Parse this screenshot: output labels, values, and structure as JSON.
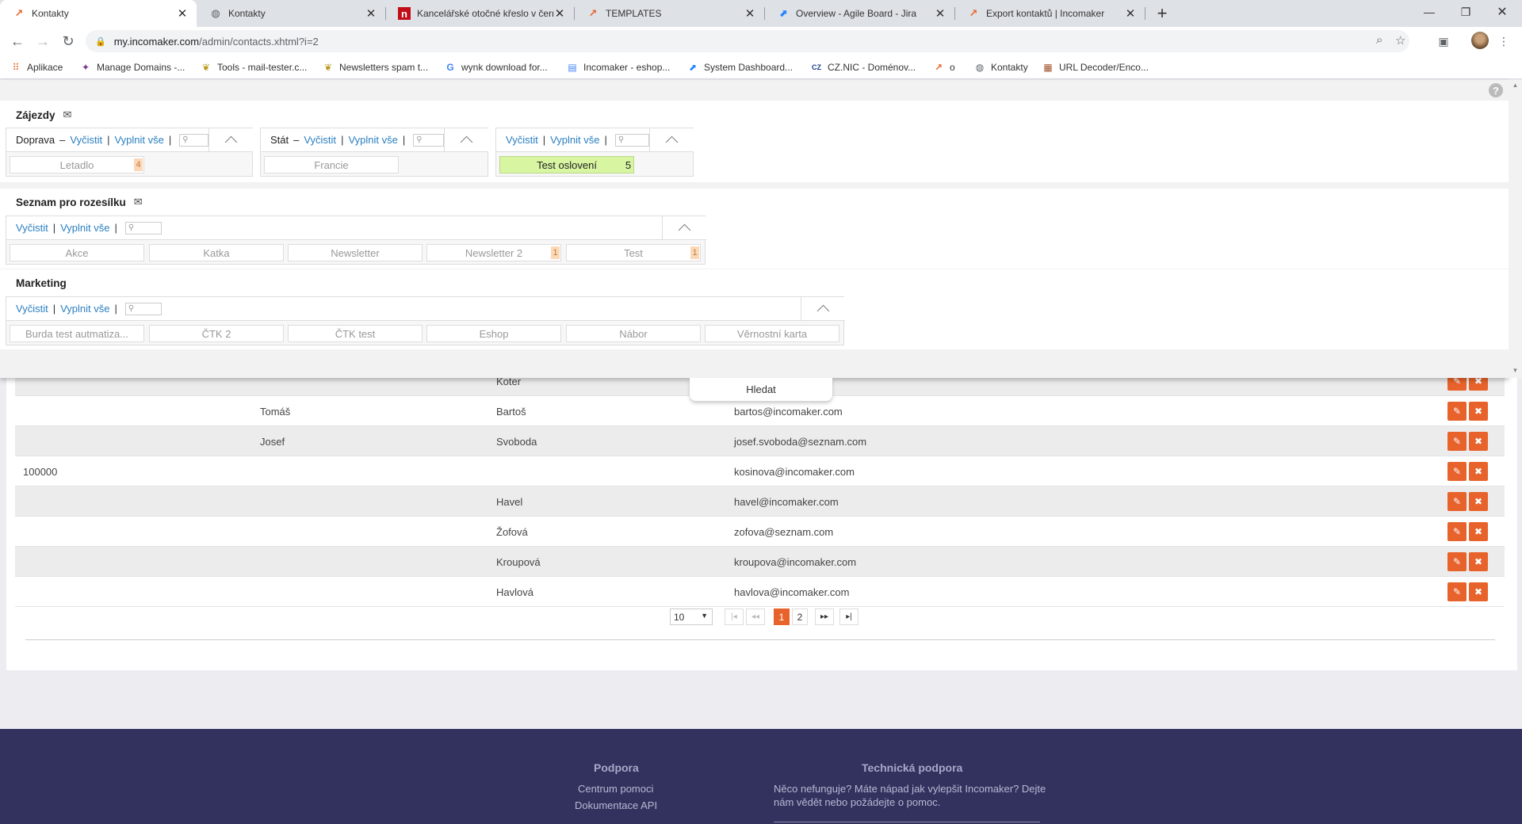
{
  "browser": {
    "tabs": [
      {
        "title": "Kontakty",
        "icon": "incomaker-icon",
        "active": true
      },
      {
        "title": "Kontakty",
        "icon": "globe-icon"
      },
      {
        "title": "Kancelářské otočné křeslo v černé",
        "icon": "n-icon"
      },
      {
        "title": "TEMPLATES",
        "icon": "incomaker-icon"
      },
      {
        "title": "Overview - Agile Board - Jira",
        "icon": "jira-icon"
      },
      {
        "title": "Export kontaktů | Incomaker",
        "icon": "incomaker-icon"
      }
    ],
    "url_domain": "my.incomaker.com",
    "url_path": "/admin/contacts.xhtml?i=2",
    "bookmarks": [
      {
        "label": "Aplikace",
        "icon": "apps-icon"
      },
      {
        "label": "Manage Domains -...",
        "icon": "wedos-icon"
      },
      {
        "label": "Tools - mail-tester.c...",
        "icon": "leaf-icon"
      },
      {
        "label": "Newsletters spam t...",
        "icon": "leaf-icon"
      },
      {
        "label": "wynk download for...",
        "icon": "google-icon"
      },
      {
        "label": "Incomaker - eshop...",
        "icon": "docs-icon"
      },
      {
        "label": "System Dashboard...",
        "icon": "jira-icon"
      },
      {
        "label": "CZ.NIC - Doménov...",
        "icon": "cznic-icon"
      },
      {
        "label": "o",
        "icon": "incomaker-icon"
      },
      {
        "label": "Kontakty",
        "icon": "globe-icon"
      },
      {
        "label": "URL Decoder/Enco...",
        "icon": "decoder-icon"
      }
    ]
  },
  "filters": {
    "zajezdy": {
      "title": "Zájezdy",
      "doprava": {
        "label": "Doprava",
        "clear": "Vyčistit",
        "fill": "Vyplnit vše",
        "chips": [
          {
            "label": "Letadlo",
            "count": "4"
          }
        ]
      },
      "stat": {
        "label": "Stát",
        "clear": "Vyčistit",
        "fill": "Vyplnit vše",
        "chips": [
          {
            "label": "Francie",
            "count": ""
          }
        ]
      },
      "third": {
        "clear": "Vyčistit",
        "fill": "Vyplnit vše",
        "chips": [
          {
            "label": "Test oslovení",
            "count": "5",
            "selected": true
          }
        ]
      }
    },
    "seznam": {
      "title": "Seznam pro rozesílku",
      "clear": "Vyčistit",
      "fill": "Vyplnit vše",
      "chips": [
        {
          "label": "Akce",
          "count": ""
        },
        {
          "label": "Katka",
          "count": ""
        },
        {
          "label": "Newsletter",
          "count": ""
        },
        {
          "label": "Newsletter 2",
          "count": "1"
        },
        {
          "label": "Test",
          "count": "1"
        }
      ]
    },
    "marketing": {
      "title": "Marketing",
      "clear": "Vyčistit",
      "fill": "Vyplnit vše",
      "chips": [
        {
          "label": "Burda test autmatiza...",
          "count": ""
        },
        {
          "label": "ČTK 2",
          "count": ""
        },
        {
          "label": "ČTK test",
          "count": ""
        },
        {
          "label": "Eshop",
          "count": ""
        },
        {
          "label": "Nábor",
          "count": ""
        },
        {
          "label": "Věrnostní karta",
          "count": ""
        }
      ]
    },
    "search_button": "Hledat"
  },
  "table": {
    "partial_row_surname": "Koter",
    "rows": [
      {
        "id": "",
        "first": "Tomáš",
        "last": "Bartoš",
        "email": "bartos@incomaker.com"
      },
      {
        "id": "",
        "first": "Josef",
        "last": "Svoboda",
        "email": "josef.svoboda@seznam.com"
      },
      {
        "id": "100000",
        "first": "",
        "last": "",
        "email": "kosinova@incomaker.com"
      },
      {
        "id": "",
        "first": "",
        "last": "Havel",
        "email": "havel@incomaker.com"
      },
      {
        "id": "",
        "first": "",
        "last": "Žofová",
        "email": "zofova@seznam.com"
      },
      {
        "id": "",
        "first": "",
        "last": "Kroupová",
        "email": "kroupova@incomaker.com"
      },
      {
        "id": "",
        "first": "",
        "last": "Havlová",
        "email": "havlova@incomaker.com"
      }
    ]
  },
  "pagination": {
    "page_size": "10",
    "pages": [
      "1",
      "2"
    ],
    "current": "1"
  },
  "footer": {
    "support": {
      "heading": "Podpora",
      "links": [
        "Centrum pomoci",
        "Dokumentace API"
      ]
    },
    "tech": {
      "heading": "Technická podpora",
      "text1": "Něco nefunguje? Máte nápad jak vylepšit Incomaker? Dejte",
      "text2": "nám vědět nebo požádejte o pomoc."
    }
  }
}
